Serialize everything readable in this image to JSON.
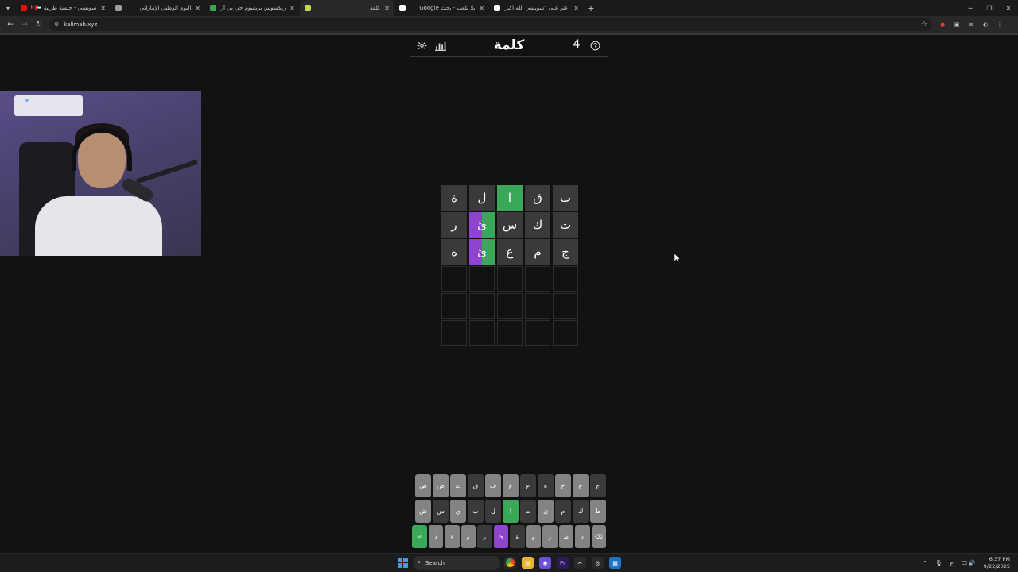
{
  "browser": {
    "tabs": [
      {
        "title": "سويسي - جلسة طربية 🇦🇪 ❤️",
        "favicon": "youtube-icon",
        "color": "#ff0000"
      },
      {
        "title": "اليوم الوطني الإماراتي",
        "favicon": "globe-icon",
        "color": "#9e9e9e"
      },
      {
        "title": "ريكسوس بريميوم جي بي آر دبي",
        "favicon": "map-pin-icon",
        "color": "#34a853"
      },
      {
        "title": "كلمة",
        "favicon": "kalimah-icon",
        "color": "#c5d94a"
      },
      {
        "title": "يلا نلعب - بحث Google",
        "favicon": "google-icon",
        "color": "#ffffff"
      },
      {
        "title": "اعثر على \"سويسي الله اكبر صرت ...",
        "favicon": "tiktok-icon",
        "color": "#ffffff"
      }
    ],
    "active_tab": 3,
    "url": "kalimah.xyz"
  },
  "game": {
    "title": "كلمة",
    "streak": "4",
    "board": [
      [
        {
          "l": "ب",
          "s": "absent"
        },
        {
          "l": "ق",
          "s": "absent"
        },
        {
          "l": "ا",
          "s": "correct"
        },
        {
          "l": "ل",
          "s": "absent"
        },
        {
          "l": "ة",
          "s": "absent"
        }
      ],
      [
        {
          "l": "ت",
          "s": "absent"
        },
        {
          "l": "ك",
          "s": "absent"
        },
        {
          "l": "س",
          "s": "absent"
        },
        {
          "l": "ئ",
          "s": "split"
        },
        {
          "l": "ر",
          "s": "absent"
        }
      ],
      [
        {
          "l": "ج",
          "s": "absent"
        },
        {
          "l": "م",
          "s": "absent"
        },
        {
          "l": "ع",
          "s": "absent"
        },
        {
          "l": "ئ",
          "s": "split"
        },
        {
          "l": "ه",
          "s": "absent"
        }
      ],
      [
        {
          "l": "",
          "s": "empty"
        },
        {
          "l": "",
          "s": "empty"
        },
        {
          "l": "",
          "s": "empty"
        },
        {
          "l": "",
          "s": "empty"
        },
        {
          "l": "",
          "s": "empty"
        }
      ],
      [
        {
          "l": "",
          "s": "empty"
        },
        {
          "l": "",
          "s": "empty"
        },
        {
          "l": "",
          "s": "empty"
        },
        {
          "l": "",
          "s": "empty"
        },
        {
          "l": "",
          "s": "empty"
        }
      ],
      [
        {
          "l": "",
          "s": "empty"
        },
        {
          "l": "",
          "s": "empty"
        },
        {
          "l": "",
          "s": "empty"
        },
        {
          "l": "",
          "s": "empty"
        },
        {
          "l": "",
          "s": "empty"
        }
      ]
    ]
  },
  "keyboard": {
    "rows": [
      [
        {
          "k": "ج",
          "s": "absent"
        },
        {
          "k": "ح",
          "s": "normal"
        },
        {
          "k": "خ",
          "s": "normal"
        },
        {
          "k": "ه",
          "s": "absent"
        },
        {
          "k": "ع",
          "s": "absent"
        },
        {
          "k": "غ",
          "s": "normal"
        },
        {
          "k": "ف",
          "s": "normal"
        },
        {
          "k": "ق",
          "s": "absent"
        },
        {
          "k": "ث",
          "s": "normal"
        },
        {
          "k": "ص",
          "s": "normal"
        },
        {
          "k": "ض",
          "s": "normal"
        }
      ],
      [
        {
          "k": "ط",
          "s": "normal"
        },
        {
          "k": "ك",
          "s": "absent"
        },
        {
          "k": "م",
          "s": "absent"
        },
        {
          "k": "ن",
          "s": "normal"
        },
        {
          "k": "ت",
          "s": "absent"
        },
        {
          "k": "ا",
          "s": "correct"
        },
        {
          "k": "ل",
          "s": "absent"
        },
        {
          "k": "ب",
          "s": "absent"
        },
        {
          "k": "ي",
          "s": "normal"
        },
        {
          "k": "س",
          "s": "absent"
        },
        {
          "k": "ش",
          "s": "normal"
        }
      ],
      [
        {
          "k": "⌫",
          "s": "normal"
        },
        {
          "k": "د",
          "s": "normal"
        },
        {
          "k": "ظ",
          "s": "normal"
        },
        {
          "k": "ز",
          "s": "normal"
        },
        {
          "k": "و",
          "s": "normal"
        },
        {
          "k": "ة",
          "s": "absent"
        },
        {
          "k": "ئ",
          "s": "present"
        },
        {
          "k": "ر",
          "s": "absent"
        },
        {
          "k": "ؤ",
          "s": "normal"
        },
        {
          "k": "ء",
          "s": "normal"
        },
        {
          "k": "ذ",
          "s": "normal"
        },
        {
          "k": "⏎",
          "s": "correct"
        }
      ]
    ]
  },
  "taskbar": {
    "search_label": "Search",
    "time": "6:37 PM",
    "date": "9/22/2025",
    "lang": "ع"
  }
}
